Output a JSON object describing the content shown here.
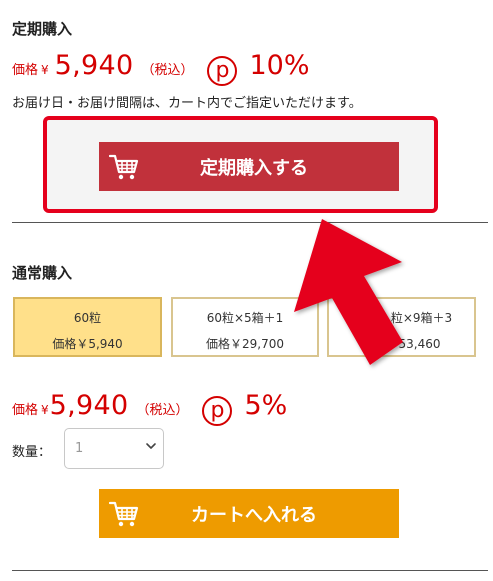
{
  "subscription": {
    "title": "定期購入",
    "price_label": "価格",
    "currency": "¥",
    "price": "5,940",
    "tax_label": "（税込）",
    "point_icon": "p",
    "point_rate": "10%",
    "note": "お届け日・お届け間隔は、カート内でご指定いただけます。",
    "button_label": "定期購入する",
    "button_icon": "cart-icon"
  },
  "regular": {
    "title": "通常購入",
    "options": [
      {
        "name": "60粒",
        "price": "価格￥5,940",
        "selected": true
      },
      {
        "name": "60粒×5箱＋1",
        "price": "価格￥29,700",
        "selected": false
      },
      {
        "name": "粒×9箱＋3",
        "price": "価格￥53,460",
        "selected": false
      }
    ],
    "price_label": "価格",
    "currency": "¥",
    "price": "5,940",
    "tax_label": "（税込）",
    "point_icon": "p",
    "point_rate": "5%",
    "quantity_label": "数量：",
    "quantity_value": "1",
    "button_label": "カートへ入れる",
    "button_icon": "cart-icon"
  },
  "colors": {
    "price_red": "#d40000",
    "subscribe_button": "#c1313b",
    "cart_button": "#ee9b00",
    "highlight_border": "#e5001c",
    "selected_option": "#ffe08a",
    "arrow": "#e5001c"
  }
}
